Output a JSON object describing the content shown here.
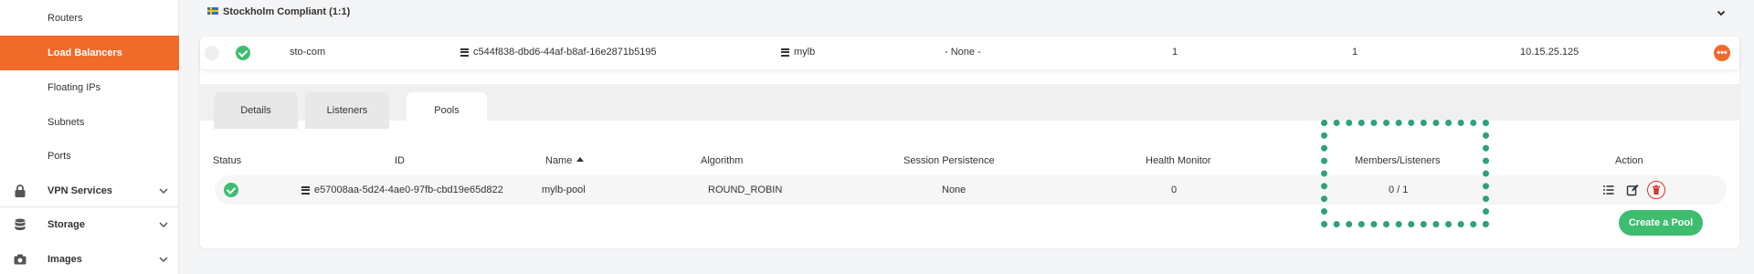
{
  "sidebar": {
    "items": [
      {
        "label": "Routers",
        "active": false
      },
      {
        "label": "Load Balancers",
        "active": true
      },
      {
        "label": "Floating IPs",
        "active": false
      },
      {
        "label": "Subnets",
        "active": false
      },
      {
        "label": "Ports",
        "active": false
      }
    ],
    "groups": [
      {
        "label": "VPN Services",
        "icon": "lock-icon"
      },
      {
        "label": "Storage",
        "icon": "database-icon"
      },
      {
        "label": "Images",
        "icon": "camera-icon"
      }
    ]
  },
  "region": {
    "flag": "sweden-flag-icon",
    "label": "Stockholm Compliant (1:1)"
  },
  "load_balancer": {
    "name": "sto-com",
    "id": "c544f838-dbd6-44af-b8af-16e2871b5195",
    "network": "mylb",
    "floating": "- None -",
    "count_a": "1",
    "count_b": "1",
    "ip": "10.15.25.125",
    "more_label": "•••"
  },
  "tabs": [
    {
      "label": "Details",
      "active": false
    },
    {
      "label": "Listeners",
      "active": false
    },
    {
      "label": "Pools",
      "active": true
    }
  ],
  "pools_table": {
    "headers": {
      "status": "Status",
      "id": "ID",
      "name": "Name",
      "algorithm": "Algorithm",
      "session": "Session Persistence",
      "health": "Health Monitor",
      "members": "Members/Listeners",
      "action": "Action"
    },
    "rows": [
      {
        "id": "e57008aa-5d24-4ae0-97fb-cbd19e65d822",
        "name": "mylb-pool",
        "algorithm": "ROUND_ROBIN",
        "session": "None",
        "health": "0",
        "members": "0 / 1"
      }
    ]
  },
  "create_pool_label": "Create a Pool",
  "colors": {
    "accent": "#f06a2a",
    "success": "#3ebd6f",
    "danger": "#e0322f",
    "highlight": "#2fa07f"
  }
}
